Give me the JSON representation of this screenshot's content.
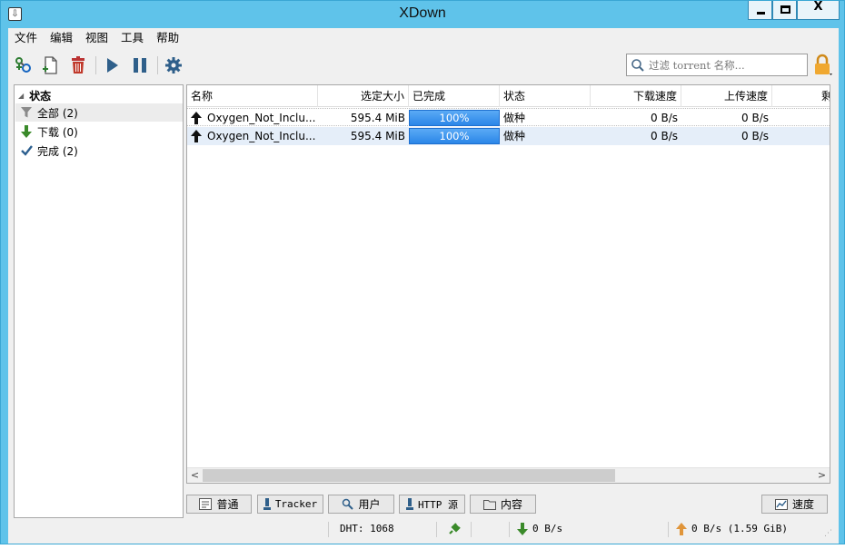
{
  "window": {
    "title": "XDown",
    "title_bar_color": "#5fc3ea",
    "min_icon": "minimize-icon",
    "max_icon": "maximize-icon",
    "close_glyph": "X"
  },
  "menu": [
    "文件",
    "编辑",
    "视图",
    "工具",
    "帮助"
  ],
  "toolbar": {
    "icons": [
      "add-magnet-icon",
      "add-torrent-file-icon",
      "delete-icon",
      "resume-icon",
      "pause-icon",
      "settings-icon"
    ],
    "search_placeholder": "过滤 torrent 名称...",
    "lock_icon": "lock-icon"
  },
  "sidebar": {
    "header": "状态",
    "items": [
      {
        "label": "全部 (2)",
        "icon": "filter-icon",
        "selected": true
      },
      {
        "label": "下载 (0)",
        "icon": "download-arrow-icon",
        "selected": false
      },
      {
        "label": "完成 (2)",
        "icon": "checkmark-icon",
        "selected": false
      }
    ]
  },
  "table": {
    "columns": [
      "名称",
      "选定大小",
      "已完成",
      "状态",
      "下载速度",
      "上传速度",
      "剩"
    ],
    "rows": [
      {
        "name": "Oxygen_Not_Inclu...",
        "size": "595.4 MiB",
        "progress": "100%",
        "progress_value": 1.0,
        "status": "做种",
        "down_speed": "0 B/s",
        "up_speed": "0 B/s"
      },
      {
        "name": "Oxygen_Not_Inclu...",
        "size": "595.4 MiB",
        "progress": "100%",
        "progress_value": 1.0,
        "status": "做种",
        "down_speed": "0 B/s",
        "up_speed": "0 B/s"
      }
    ],
    "progress_color": "#3b8ff0",
    "scroll_left": "<",
    "scroll_right": ">"
  },
  "tabs": [
    {
      "label": "普通",
      "icon": "general-icon"
    },
    {
      "label": "Tracker",
      "icon": "tracker-icon"
    },
    {
      "label": "用户",
      "icon": "peers-icon"
    },
    {
      "label": "HTTP 源",
      "icon": "http-source-icon"
    },
    {
      "label": "内容",
      "icon": "folder-icon"
    },
    {
      "label": "速度",
      "icon": "chart-icon"
    }
  ],
  "statusbar": {
    "dht": "DHT: 1068",
    "download": "0 B/s",
    "upload": "0 B/s (1.59 GiB)",
    "connection_icon": "plug-icon"
  }
}
